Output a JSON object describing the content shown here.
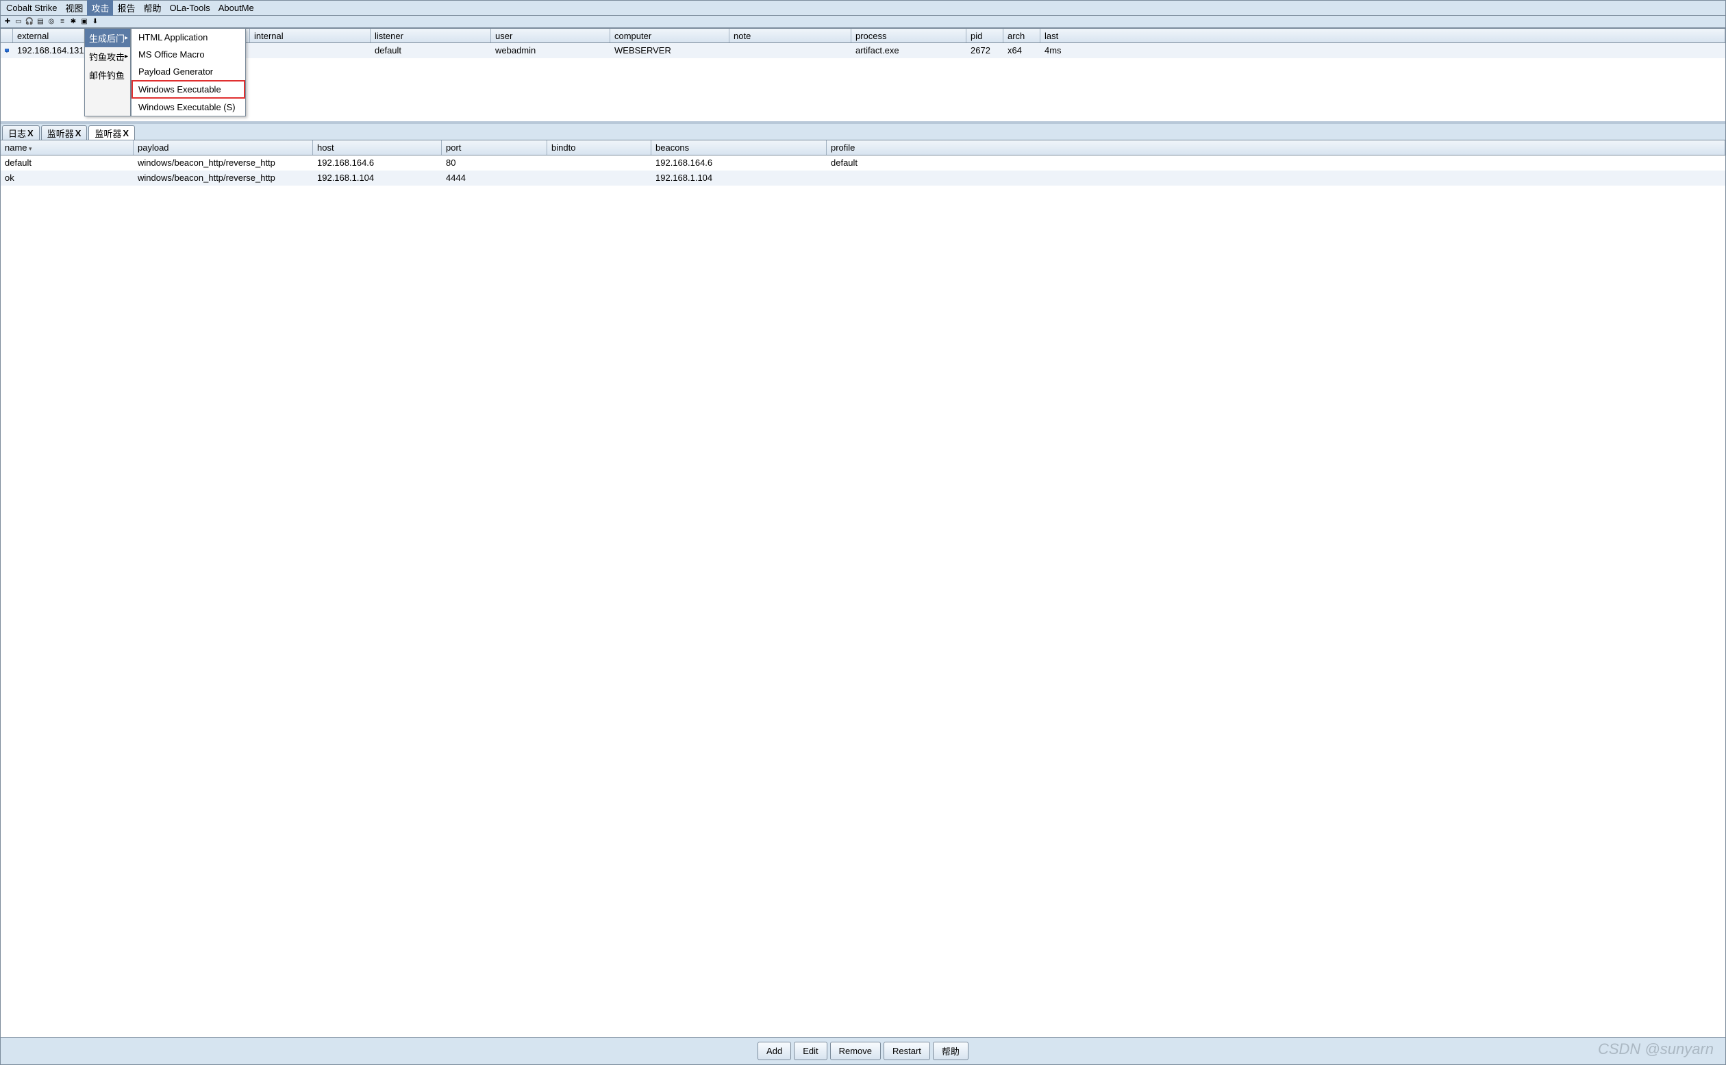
{
  "menubar": [
    "Cobalt Strike",
    "视图",
    "攻击",
    "报告",
    "帮助",
    "OLa-Tools",
    "AboutMe"
  ],
  "menubar_active_index": 2,
  "dropdown1": [
    {
      "label": "生成后门",
      "hl": true,
      "sub": true
    },
    {
      "label": "钓鱼攻击",
      "hl": false,
      "sub": true
    },
    {
      "label": "邮件钓鱼",
      "hl": false,
      "sub": false
    }
  ],
  "dropdown2": [
    {
      "label": "HTML Application"
    },
    {
      "label": "MS Office Macro"
    },
    {
      "label": "Payload Generator"
    },
    {
      "label": "Windows Executable",
      "boxed": true
    },
    {
      "label": "Windows Executable (S)"
    }
  ],
  "sessions": {
    "headers": [
      "external",
      "internal",
      "listener",
      "user",
      "computer",
      "note",
      "process",
      "pid",
      "arch",
      "last"
    ],
    "rows": [
      {
        "external": "192.168.164.131",
        "internal": "",
        "listener": "default",
        "user": "webadmin",
        "computer": "WEBSERVER",
        "note": "",
        "process": "artifact.exe",
        "pid": "2672",
        "arch": "x64",
        "last": "4ms"
      }
    ]
  },
  "tabs": [
    {
      "label": "日志",
      "active": false
    },
    {
      "label": "监听器",
      "active": false
    },
    {
      "label": "监听器",
      "active": true
    }
  ],
  "listeners": {
    "headers": [
      "name",
      "payload",
      "host",
      "port",
      "bindto",
      "beacons",
      "profile"
    ],
    "rows": [
      {
        "name": "default",
        "payload": "windows/beacon_http/reverse_http",
        "host": "192.168.164.6",
        "port": "80",
        "bindto": "",
        "beacons": "192.168.164.6",
        "profile": "default"
      },
      {
        "name": "ok",
        "payload": "windows/beacon_http/reverse_http",
        "host": "192.168.1.104",
        "port": "4444",
        "bindto": "",
        "beacons": "192.168.1.104",
        "profile": ""
      }
    ]
  },
  "buttons": [
    "Add",
    "Edit",
    "Remove",
    "Restart",
    "帮助"
  ],
  "watermark": "CSDN @sunyarn"
}
